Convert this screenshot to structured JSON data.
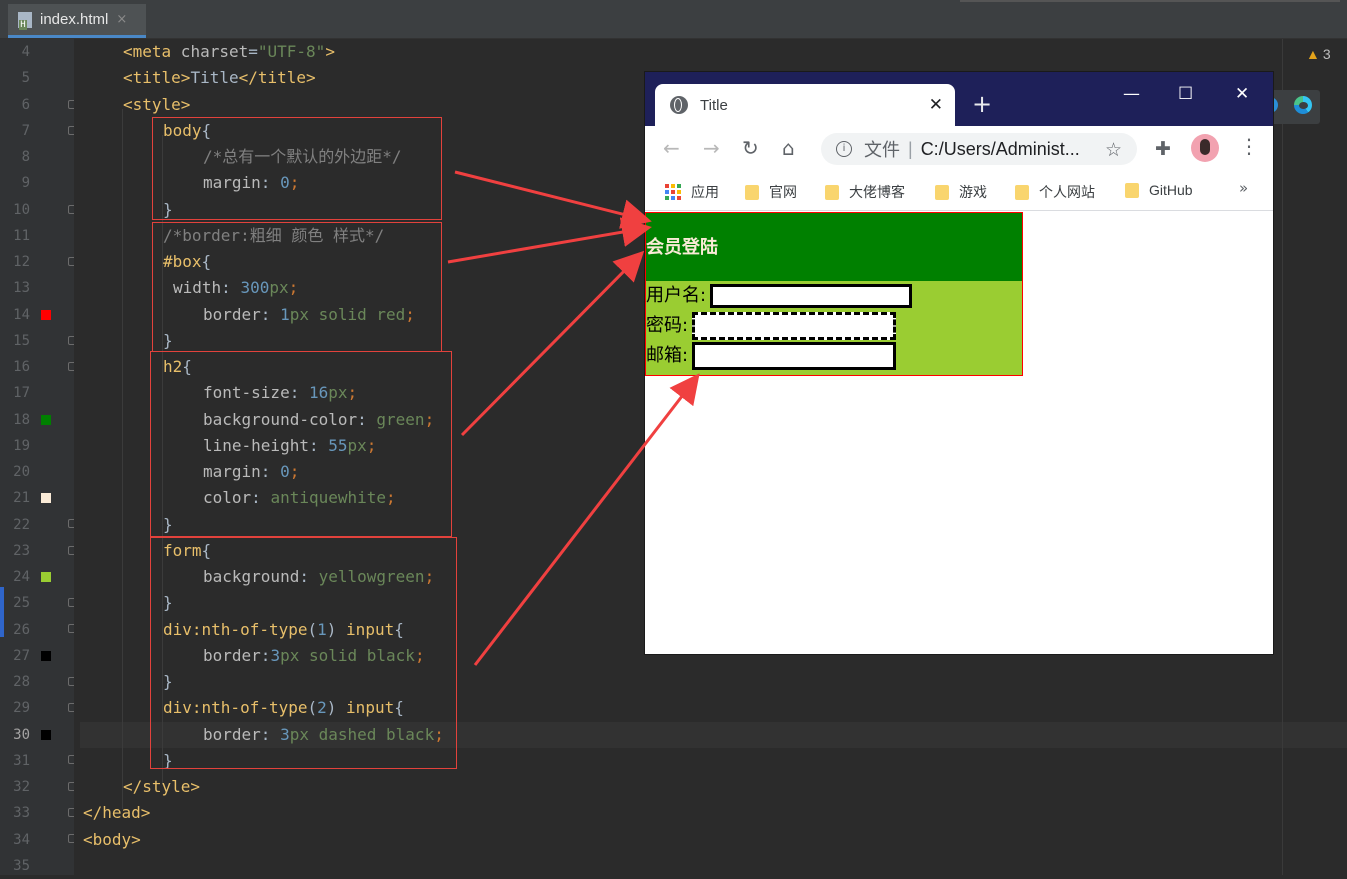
{
  "tab": {
    "filename": "index.html",
    "close": "×"
  },
  "warnings": {
    "count": "3"
  },
  "colors": {
    "accent_red": "#f04040",
    "gutter_red": "#ff0000",
    "gutter_green": "#008000",
    "gutter_antiquewhite": "#faebd7",
    "gutter_yellowgreen": "#9acd32",
    "gutter_black": "#000000"
  },
  "editor": {
    "lines": [
      {
        "n": "4"
      },
      {
        "n": "5"
      },
      {
        "n": "6"
      },
      {
        "n": "7"
      },
      {
        "n": "8"
      },
      {
        "n": "9"
      },
      {
        "n": "10"
      },
      {
        "n": "11"
      },
      {
        "n": "12"
      },
      {
        "n": "13"
      },
      {
        "n": "14"
      },
      {
        "n": "15"
      },
      {
        "n": "16"
      },
      {
        "n": "17"
      },
      {
        "n": "18"
      },
      {
        "n": "19"
      },
      {
        "n": "20"
      },
      {
        "n": "21"
      },
      {
        "n": "22"
      },
      {
        "n": "23"
      },
      {
        "n": "24"
      },
      {
        "n": "25"
      },
      {
        "n": "26"
      },
      {
        "n": "27"
      },
      {
        "n": "28"
      },
      {
        "n": "29"
      },
      {
        "n": "30"
      },
      {
        "n": "31"
      },
      {
        "n": "32"
      },
      {
        "n": "33"
      },
      {
        "n": "34"
      },
      {
        "n": "35"
      }
    ],
    "code": {
      "l4a": "<meta",
      "l4b": " charset",
      "l4c": "=",
      "l4d": "\"UTF-8\"",
      "l4e": ">",
      "l5a": "<title>",
      "l5b": "Title",
      "l5c": "</title>",
      "l6": "<style>",
      "l7a": "body",
      "l7b": "{",
      "l8": "/*总有一个默认的外边距*/",
      "l9a": "margin",
      "l9b": ": ",
      "l9c": "0",
      "l9d": ";",
      "l10": "}",
      "l11": "/*border:粗细 颜色 样式*/",
      "l12a": "#box",
      "l12b": "{",
      "l13a": "width",
      "l13b": ": ",
      "l13c": "300",
      "l13d": "px",
      "l13e": ";",
      "l14a": "border",
      "l14b": ": ",
      "l14c": "1",
      "l14d": "px solid red",
      "l14e": ";",
      "l15": "}",
      "l16a": "h2",
      "l16b": "{",
      "l17a": "font-size",
      "l17b": ": ",
      "l17c": "16",
      "l17d": "px",
      "l17e": ";",
      "l18a": "background-color",
      "l18b": ": ",
      "l18c": "green",
      "l18d": ";",
      "l19a": "line-height",
      "l19b": ": ",
      "l19c": "55",
      "l19d": "px",
      "l19e": ";",
      "l20a": "margin",
      "l20b": ": ",
      "l20c": "0",
      "l20d": ";",
      "l21a": "color",
      "l21b": ": ",
      "l21c": "antiquewhite",
      "l21d": ";",
      "l22": "}",
      "l23a": "form",
      "l23b": "{",
      "l24a": "background",
      "l24b": ": ",
      "l24c": "yellowgreen",
      "l24d": ";",
      "l25": "}",
      "l26a": "div:nth-of-type",
      "l26b": "(",
      "l26c": "1",
      "l26d": ") ",
      "l26e": "input",
      "l26f": "{",
      "l27a": "border",
      "l27b": ":",
      "l27c": "3",
      "l27d": "px solid black",
      "l27e": ";",
      "l28": "}",
      "l29a": "div:nth-of-type",
      "l29b": "(",
      "l29c": "2",
      "l29d": ") ",
      "l29e": "input",
      "l29f": "{",
      "l30a": "border",
      "l30b": ": ",
      "l30c": "3",
      "l30d": "px dashed black",
      "l30e": ";",
      "l31": "}",
      "l32": "</style>",
      "l33": "</head>",
      "l34": "<body>"
    }
  },
  "browser": {
    "tab_title": "Title",
    "tab_close": "✕",
    "new_tab": "+",
    "minimize": "—",
    "maximize": "☐",
    "close": "✕",
    "back": "←",
    "forward": "→",
    "reload": "↻",
    "home": "⌂",
    "info": "i",
    "address_label": "文件",
    "address_sep": "|",
    "url": "C:/Users/Administ...",
    "bookmark_star": "☆",
    "extensions": "✚",
    "menu": "⋮",
    "bookmarks": [
      "应用",
      "官网",
      "大佬博客",
      "游戏",
      "个人网站",
      "GitHub"
    ],
    "more": "»",
    "page": {
      "heading": "会员登陆",
      "username_label": "用户名:",
      "password_label": "密码:",
      "email_label": "邮箱:"
    }
  }
}
